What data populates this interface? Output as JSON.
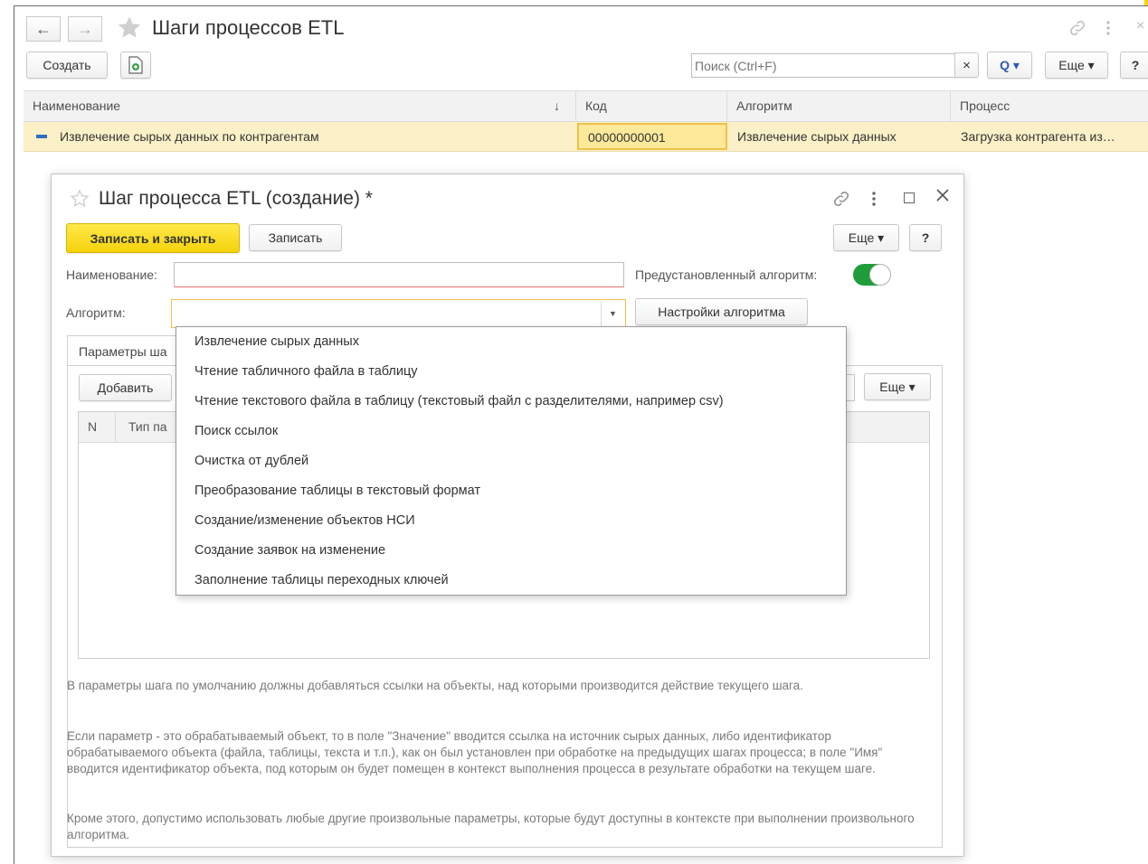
{
  "window": {
    "title": "Шаги процессов ETL",
    "back_glyph": "←",
    "forward_glyph": "→",
    "create_label": "Создать",
    "search_placeholder": "Поиск (Ctrl+F)",
    "clear_glyph": "×",
    "search_btn_label": "Q ▾",
    "more_label": "Еще ▾",
    "help_label": "?",
    "close_glyph": "×"
  },
  "grid": {
    "columns": [
      "Наименование",
      "Код",
      "Алгоритм",
      "Процесс"
    ],
    "sort_glyph": "↓",
    "rows": [
      {
        "name": "Извлечение сырых данных по контрагентам",
        "code": "00000000001",
        "algorithm": "Извлечение сырых данных",
        "process": "Загрузка контрагента из…"
      }
    ]
  },
  "dialog": {
    "title": "Шаг процесса ETL (создание) *",
    "save_close_label": "Записать и закрыть",
    "save_label": "Записать",
    "more_label": "Еще ▾",
    "help_label": "?",
    "name_label": "Наименование:",
    "name_value": "",
    "predefined_label": "Предустановленный алгоритм:",
    "predefined_on": true,
    "algorithm_label": "Алгоритм:",
    "algorithm_value": "",
    "algorithm_settings_label": "Настройки алгоритма",
    "tab_params_label": "Параметры ша",
    "add_label": "Добавить",
    "table_more_label": "Еще ▾",
    "table_headers": [
      "N",
      "Тип па"
    ],
    "hint1": "В параметры шага по умолчанию должны добавляться ссылки на объекты, над которыми производится действие текущего шага.",
    "hint2": "Если параметр - это обрабатываемый объект, то в поле \"Значение\" вводится ссылка на источник сырых данных, либо идентификатор обрабатываемого объекта (файла, таблицы, текста и т.п.), как он был установлен при обработке на предыдущих шагах процесса; в поле \"Имя\" вводится идентификатор объекта, под которым он будет помещен в контекст выполнения процесса в результате обработки на текущем шаге.",
    "hint3": "Кроме этого, допустимо использовать любые другие произвольные параметры, которые будут доступны в контексте при выполнении произвольного алгоритма."
  },
  "algorithm_options": [
    "Извлечение сырых данных",
    "Чтение табличного файла в таблицу",
    "Чтение текстового файла в таблицу (текстовый файл с разделителями, например csv)",
    "Поиск ссылок",
    "Очистка от дублей",
    "Преобразование таблицы в текстовый формат",
    "Создание/изменение объектов НСИ",
    "Создание заявок на изменение",
    "Заполнение таблицы переходных ключей"
  ],
  "colors": {
    "accent_yellow": "#f5d20a",
    "row_highlight": "#fbf0c7",
    "toggle_green": "#1f9d3a"
  }
}
